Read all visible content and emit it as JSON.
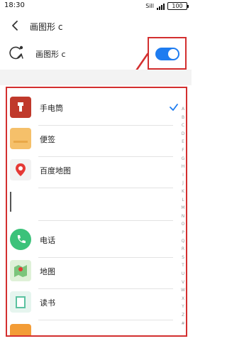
{
  "status_bar": {
    "time": "18:30",
    "signal": "Sill",
    "battery": "100"
  },
  "header": {
    "title": "画图形 c"
  },
  "setting": {
    "label": "画图形 c",
    "toggle_on": true,
    "accent_color": "#1e7cf0"
  },
  "annotation": {
    "color": "#d32f2f"
  },
  "apps": [
    {
      "label": "手电筒",
      "icon": "flashlight-icon",
      "selected": true
    },
    {
      "label": "便签",
      "icon": "notes-icon",
      "selected": false
    },
    {
      "label": "百度地图",
      "icon": "baidu-map-icon",
      "selected": false
    },
    {
      "label": "",
      "icon": "",
      "selected": false
    },
    {
      "label": "电话",
      "icon": "phone-icon",
      "selected": false
    },
    {
      "label": "地图",
      "icon": "map-icon",
      "selected": false
    },
    {
      "label": "读书",
      "icon": "book-icon",
      "selected": false
    },
    {
      "label": "",
      "icon": "orange-app-icon",
      "selected": false
    }
  ],
  "index_letters": [
    "A",
    "B",
    "C",
    "D",
    "E",
    "F",
    "G",
    "H",
    "I",
    "J",
    "K",
    "L",
    "M",
    "N",
    "O",
    "P",
    "Q",
    "R",
    "S",
    "T",
    "U",
    "V",
    "W",
    "X",
    "Y",
    "Z",
    "#"
  ]
}
